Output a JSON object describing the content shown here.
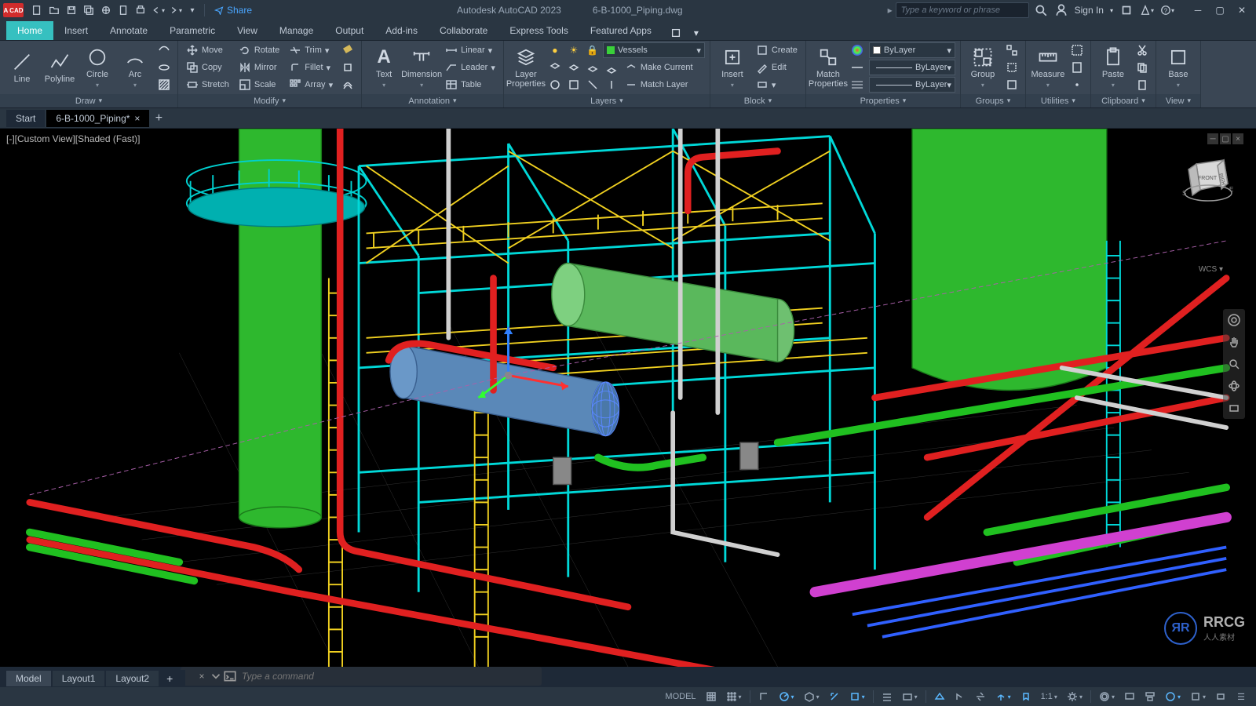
{
  "titlebar": {
    "app_badge": "A CAD",
    "share": "Share",
    "app_name": "Autodesk AutoCAD 2023",
    "file_name": "6-B-1000_Piping.dwg",
    "search_placeholder": "Type a keyword or phrase",
    "signin": "Sign In"
  },
  "ribbon_tabs": [
    "Home",
    "Insert",
    "Annotate",
    "Parametric",
    "View",
    "Manage",
    "Output",
    "Add-ins",
    "Collaborate",
    "Express Tools",
    "Featured Apps"
  ],
  "active_ribbon_tab": "Home",
  "panels": {
    "draw": {
      "title": "Draw",
      "line": "Line",
      "polyline": "Polyline",
      "circle": "Circle",
      "arc": "Arc"
    },
    "modify": {
      "title": "Modify",
      "move": "Move",
      "rotate": "Rotate",
      "trim": "Trim",
      "copy": "Copy",
      "mirror": "Mirror",
      "fillet": "Fillet",
      "stretch": "Stretch",
      "scale": "Scale",
      "array": "Array"
    },
    "annotation": {
      "title": "Annotation",
      "text": "Text",
      "dimension": "Dimension",
      "linear": "Linear",
      "leader": "Leader",
      "table": "Table"
    },
    "layers": {
      "title": "Layers",
      "layer_properties": "Layer\nProperties",
      "current_layer": "Vessels",
      "make_current": "Make Current",
      "match_layer": "Match Layer"
    },
    "block": {
      "title": "Block",
      "insert": "Insert",
      "create": "Create",
      "edit": "Edit"
    },
    "properties": {
      "title": "Properties",
      "match": "Match\nProperties",
      "color": "ByLayer",
      "ltype": "ByLayer",
      "lweight": "ByLayer"
    },
    "groups": {
      "title": "Groups",
      "group": "Group"
    },
    "utilities": {
      "title": "Utilities",
      "measure": "Measure"
    },
    "clipboard": {
      "title": "Clipboard",
      "paste": "Paste"
    },
    "view": {
      "title": "View",
      "base": "Base"
    }
  },
  "doc_tabs": {
    "start": "Start",
    "active": "6-B-1000_Piping*"
  },
  "viewport": {
    "label": "[-][Custom View][Shaded (Fast)]",
    "wcs": "WCS",
    "cube_front": "FRONT",
    "cube_right": "RIGHT"
  },
  "cmdline": {
    "placeholder": "Type a command"
  },
  "bottom_tabs": [
    "Model",
    "Layout1",
    "Layout2"
  ],
  "active_bottom_tab": "Model",
  "statusbar": {
    "model": "MODEL",
    "scale": "1:1"
  },
  "watermark": {
    "logo": "ЯR",
    "text": "RRCG",
    "sub": "人人素材"
  }
}
